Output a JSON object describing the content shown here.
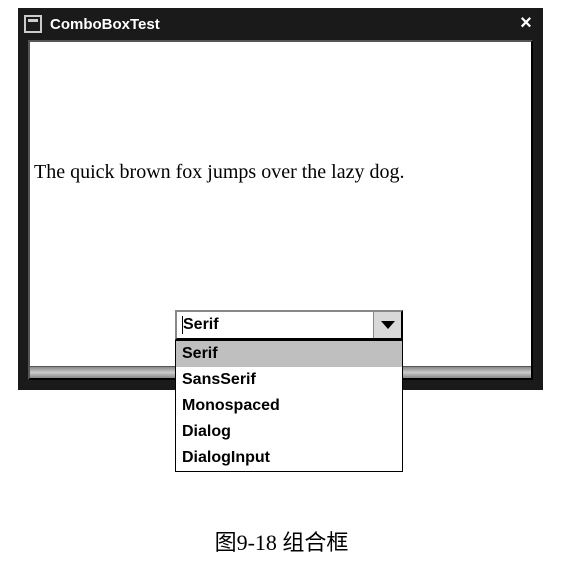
{
  "window": {
    "title": "ComboBoxTest"
  },
  "sample_text": "The quick brown fox jumps over the lazy dog.",
  "combo": {
    "value": "Serif",
    "options": [
      "Serif",
      "SansSerif",
      "Monospaced",
      "Dialog",
      "DialogInput"
    ]
  },
  "caption": "图9-18  组合框"
}
